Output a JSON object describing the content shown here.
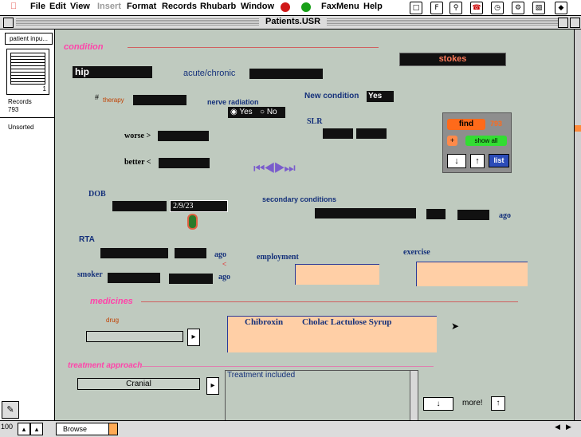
{
  "menubar": {
    "items": [
      "File",
      "Edit",
      "View",
      "Insert",
      "Format",
      "Records",
      "Rhubarb",
      "Window",
      "FaxMenu",
      "Help"
    ]
  },
  "window": {
    "title": "Patients.USR"
  },
  "status": {
    "layout": "patient inpu...",
    "book_page": "1",
    "records_label": "Records",
    "records_count": "793",
    "sort_state": "Unsorted",
    "mode": "Browse",
    "zoom": "100"
  },
  "form": {
    "condition_header": "condition",
    "condition_value": "hip",
    "acute_label": "acute/chronic",
    "stokes_value": "stokes",
    "therapy_hash": "#",
    "therapy_label": "therapy",
    "nerve_label": "nerve radiation",
    "yes_option": "Yes",
    "no_option": "No",
    "new_condition_label": "New condition",
    "new_condition_value": "Yes",
    "slr_label": "SLR",
    "worse_label": "worse >",
    "better_label": "better <",
    "dob_label": "DOB",
    "dob_value": "2/9/23",
    "secondary_label": "secondary conditions",
    "ago1": "ago",
    "rta_label": "RTA",
    "ago2": "ago",
    "lt_mark": "<",
    "employment_label": "employment",
    "exercise_label": "exercise",
    "smoker_label": "smoker",
    "ago3": "ago",
    "medicines_header": "medicines",
    "drug_label": "drug",
    "drug_1": "Chibroxin",
    "drug_2": "Cholac Lactulose Syrup",
    "treatment_header": "treatment approach",
    "approach_value": "Cranial",
    "treatment_text": "Treatment included",
    "more_label": "more!"
  },
  "find_panel": {
    "find_label": "find",
    "count": "793",
    "plus": "+",
    "show_all": "show all",
    "list": "list"
  },
  "colors": {
    "background": "#bfcabf",
    "label_blue": "#14307a",
    "pink": "#ff44aa",
    "peach": "#ffcfa6",
    "find_orange": "#ff6a1a",
    "show_all_green": "#33dd33"
  }
}
